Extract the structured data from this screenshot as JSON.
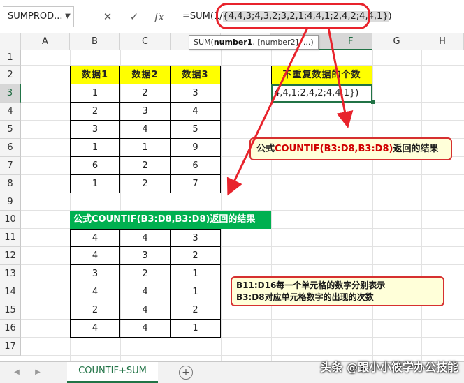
{
  "formula_bar": {
    "name_box": "SUMPROD...",
    "formula_prefix": "=SUM(1/",
    "formula_highlighted": "{4,4,3;4,3,2;3,2,1;4,4,1;2,4,2;4,4,1}",
    "formula_suffix": ")",
    "cancel_icon": "✕",
    "confirm_icon": "✓",
    "fx_label": "fx",
    "tooltip_fn": "SUM(",
    "tooltip_arg1": "number1",
    "tooltip_rest": ", [number2], ...)"
  },
  "columns": [
    "A",
    "B",
    "C",
    "D",
    "E",
    "F",
    "G",
    "H"
  ],
  "rows": [
    "1",
    "2",
    "3",
    "4",
    "5",
    "6",
    "7",
    "8",
    "9",
    "10",
    "11",
    "12",
    "13",
    "14",
    "15",
    "16",
    "17"
  ],
  "table1": {
    "headers": [
      "数据1",
      "数据2",
      "数据3"
    ],
    "rows": [
      [
        "1",
        "2",
        "3"
      ],
      [
        "2",
        "3",
        "4"
      ],
      [
        "3",
        "4",
        "5"
      ],
      [
        "1",
        "1",
        "9"
      ],
      [
        "6",
        "2",
        "6"
      ],
      [
        "1",
        "2",
        "7"
      ]
    ]
  },
  "g2_header": "不重复数据的个数",
  "g3_value": "4,4,1;2,4,2;4,4,1})",
  "callout1": {
    "prefix": "公式",
    "formula": "COUNTIF(B3:D8,B3:D8)",
    "suffix": "返回的结果"
  },
  "green_title": "公式COUNTIF(B3:D8,B3:D8)返回的结果",
  "table2": {
    "rows": [
      [
        "4",
        "4",
        "3"
      ],
      [
        "4",
        "3",
        "2"
      ],
      [
        "3",
        "2",
        "1"
      ],
      [
        "4",
        "4",
        "1"
      ],
      [
        "2",
        "4",
        "2"
      ],
      [
        "4",
        "4",
        "1"
      ]
    ]
  },
  "callout2": {
    "line1": "B11:D16每一个单元格的数字分别表示",
    "line2": "B3:D8对应单元格数字的出现的次数"
  },
  "sheet_tab": "COUNTIF+SUM",
  "add_sheet": "+",
  "watermark": "头条 @跟小小筱学办公技能",
  "colors": {
    "header_yellow": "#ffff00",
    "title_green": "#00b050",
    "arrow_red": "#e8232c",
    "excel_green": "#217346"
  }
}
